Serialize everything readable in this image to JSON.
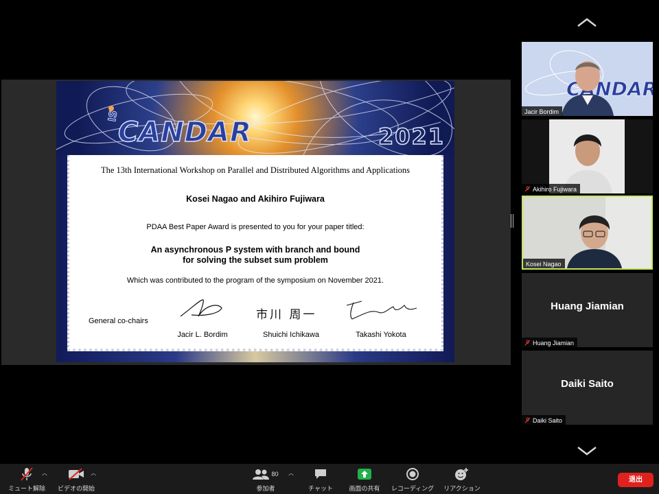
{
  "certificate": {
    "logo_small": "IS",
    "logo": "CANDAR",
    "year": "2021",
    "workshop": "The 13th International Workshop on Parallel and Distributed Algorithms and Applications",
    "authors": "Kosei Nagao and Akihiro Fujiwara",
    "award": "PDAA Best Paper Award is presented to you for your paper titled:",
    "title_line1": "An asynchronous P system with branch and bound",
    "title_line2": "for solving the subset sum problem",
    "contributed": "Which was contributed to the program of the symposium on November 2021.",
    "cochairs_label": "General co-chairs",
    "signers": [
      "Jacir L. Bordim",
      "Shuichi Ichikawa",
      "Takashi Yokota"
    ],
    "signature_2_text": "市川 周一"
  },
  "participants": [
    {
      "name": "Jacir Bordim",
      "video": true,
      "muted": false,
      "speaking": false
    },
    {
      "name": "Akihiro Fujiwara",
      "video": true,
      "muted": true,
      "speaking": false
    },
    {
      "name": "Kosei Nagao",
      "video": true,
      "muted": false,
      "speaking": true
    },
    {
      "name": "Huang Jiamian",
      "video": false,
      "muted": true,
      "speaking": false
    },
    {
      "name": "Daiki Saito",
      "video": false,
      "muted": true,
      "speaking": false
    }
  ],
  "toolbar": {
    "unmute": "ミュート解除",
    "start_video": "ビデオの開始",
    "participants": "参加者",
    "participants_count": "80",
    "chat": "チャット",
    "share_screen": "画面の共有",
    "recording": "レコーディング",
    "reactions": "リアクション",
    "end": "退出"
  },
  "colors": {
    "active_speaker_border": "#c5e65c",
    "share_green": "#23b04c",
    "end_red": "#e0221e"
  }
}
